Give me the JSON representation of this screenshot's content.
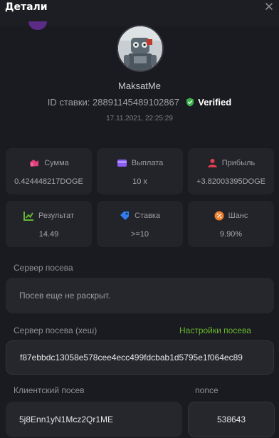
{
  "header": {
    "title": "Детали"
  },
  "profile": {
    "username": "MaksatMe",
    "bet_id_label": "ID ставки:",
    "bet_id": "28891145489102867",
    "verified": "Verified",
    "datetime": "17.11.2021, 22:25:29"
  },
  "stats": [
    {
      "icon": "coins-icon",
      "label": "Сумма",
      "value": "0.424448217DOGE",
      "color": "#e0407a"
    },
    {
      "icon": "wallet-icon",
      "label": "Выплата",
      "value": "10 x",
      "color": "#8b5cf6"
    },
    {
      "icon": "profit-icon",
      "label": "Прибыль",
      "value": "+3.82003395DOGE",
      "color": "#e23d4e"
    },
    {
      "icon": "result-chart-icon",
      "label": "Результат",
      "value": "14.49",
      "color": "#65b530"
    },
    {
      "icon": "tag-icon",
      "label": "Ставка",
      "value": ">=10",
      "color": "#2f7df0"
    },
    {
      "icon": "percent-icon",
      "label": "Шанс",
      "value": "9.90%",
      "color": "#f07f2a"
    }
  ],
  "seed": {
    "server_label": "Сервер посева",
    "server_value": "Посев еще не раскрыт.",
    "server_hash_label": "Сервер посева (хеш)",
    "settings_link": "Настройки посева",
    "server_hash_value": "f87ebbdc13058e578cee4ecc499fdcbab1d5795e1f064ec89",
    "client_label": "Клиентский посев",
    "client_value": "5j8Enn1yN1Mcz2Qr1ME",
    "nonce_label": "nonce",
    "nonce_value": "538643"
  }
}
